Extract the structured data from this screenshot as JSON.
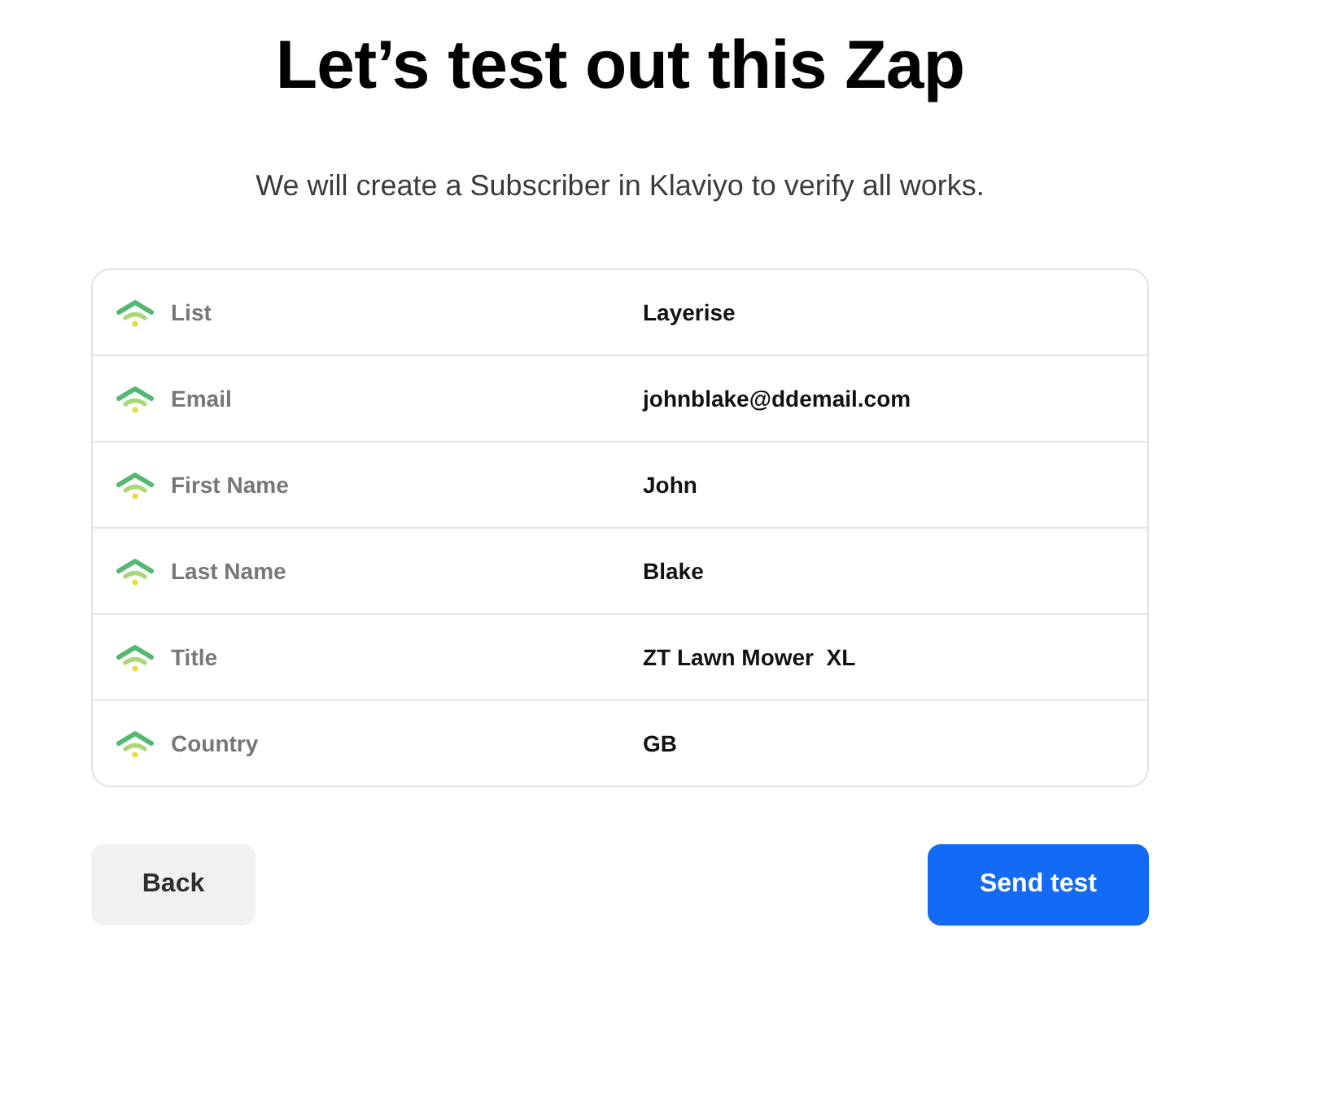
{
  "title": "Let’s test out this Zap",
  "subtitle": "We will create a Subscriber in Klaviyo to verify all works.",
  "fields": [
    {
      "label": "List",
      "value": "Layerise"
    },
    {
      "label": "Email",
      "value": "johnblake@ddemail.com"
    },
    {
      "label": "First Name",
      "value": "John"
    },
    {
      "label": "Last Name",
      "value": "Blake"
    },
    {
      "label": "Title",
      "value": "ZT Lawn Mower  XL"
    },
    {
      "label": "Country",
      "value": "GB"
    }
  ],
  "buttons": [
    {
      "label": "Back",
      "kind": "secondary"
    },
    {
      "label": "Send test",
      "kind": "primary"
    }
  ]
}
